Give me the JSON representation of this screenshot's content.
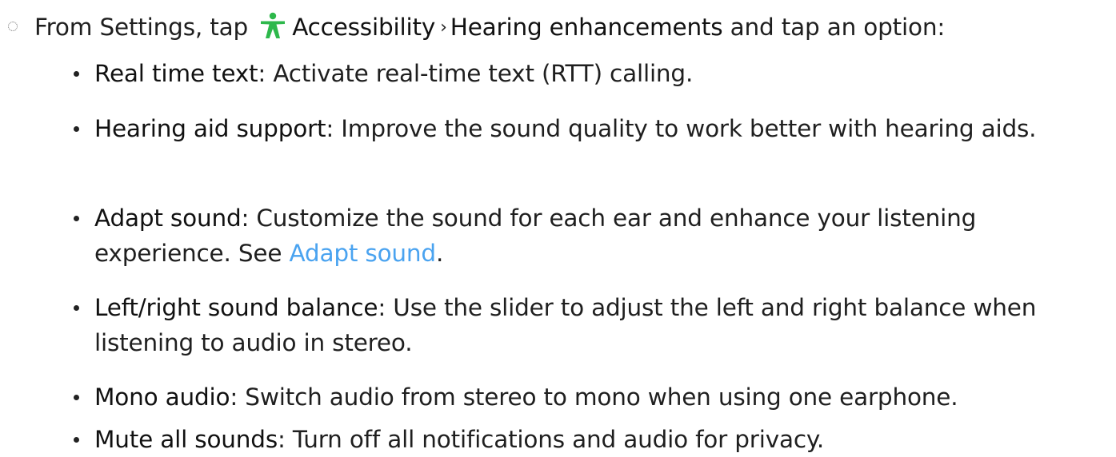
{
  "step": {
    "prefix": "From Settings, tap",
    "accessibility_label": "Accessibility",
    "separator": "›",
    "hearing_label": "Hearing enhancements",
    "suffix": "and tap an option:",
    "icon_color": "#2db84b"
  },
  "options": [
    {
      "term": "Real time text",
      "description": ": Activate real-time text (RTT) calling."
    },
    {
      "term": "Hearing aid support",
      "description": ": Improve the sound quality to work better with hearing aids."
    },
    {
      "term": "Adapt sound",
      "description": ": Customize the sound for each ear and enhance your listening experience. See ",
      "link": "Adapt sound",
      "end": "."
    },
    {
      "term": "Left/right sound balance",
      "description": ": Use the slider to adjust the left and right balance when listening to audio in stereo."
    },
    {
      "term": "Mono audio",
      "description": ": Switch audio from stereo to mono when using one earphone."
    },
    {
      "term": "Mute all sounds",
      "description": ": Turn off all notifications and audio for privacy."
    }
  ],
  "colors": {
    "link": "#4aa3f0",
    "text": "#1f1f1f"
  }
}
